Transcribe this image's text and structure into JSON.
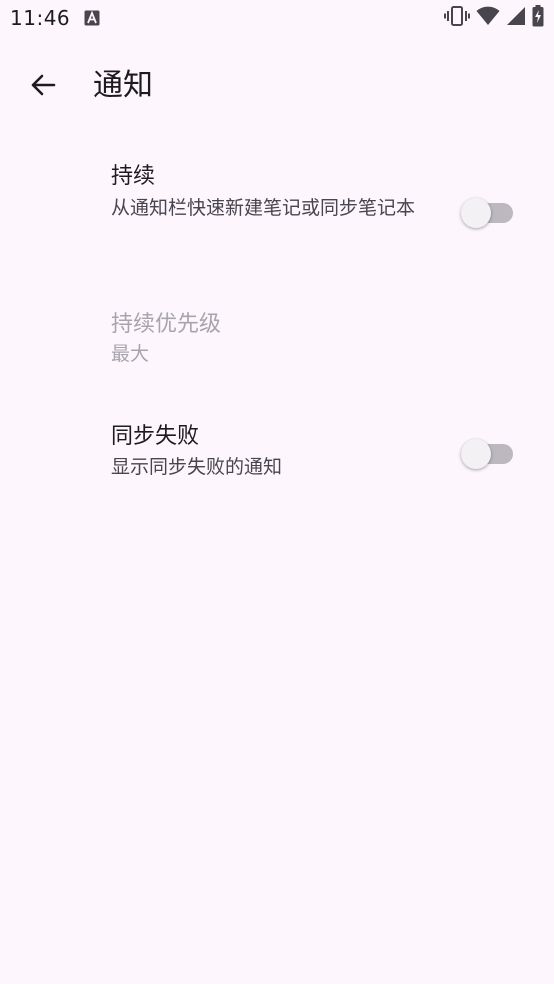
{
  "status_bar": {
    "time": "11:46",
    "notification_icon": "a-icon",
    "icons": [
      "vibrate-icon",
      "wifi-icon",
      "cell-signal-icon",
      "battery-charging-icon"
    ]
  },
  "app_bar": {
    "back_icon": "arrow-back-icon",
    "title": "通知"
  },
  "preferences": [
    {
      "title": "持续",
      "summary": "从通知栏快速新建笔记或同步笔记本",
      "has_switch": true,
      "switch_on": false,
      "enabled": true
    },
    {
      "title": "持续优先级",
      "summary": "最大",
      "has_switch": false,
      "enabled": false
    },
    {
      "title": "同步失败",
      "summary": "显示同步失败的通知",
      "has_switch": true,
      "switch_on": false,
      "enabled": true
    }
  ],
  "colors": {
    "background": "#fdf7fd",
    "text_primary": "#1d1b20",
    "text_secondary": "#49454f",
    "text_disabled": "#a8a4ad",
    "switch_track_off": "#bdb8c0",
    "switch_thumb_off": "#f4f1f4"
  }
}
